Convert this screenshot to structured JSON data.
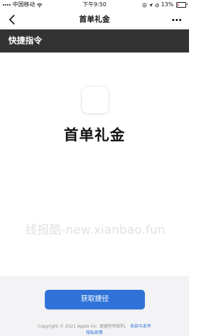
{
  "status_bar": {
    "carrier": "中国移动",
    "time": "下午9:50",
    "battery_percent": "13%",
    "battery_level": 0.13,
    "icons": [
      "wifi-icon",
      "location-icon",
      "alarm-icon",
      "battery-icon"
    ]
  },
  "nav": {
    "title": "首单礼金",
    "back_icon": "chevron-left-icon",
    "more_icon": "more-horizontal-icon"
  },
  "section": {
    "title": "快捷指令"
  },
  "shortcut": {
    "name": "首单礼金"
  },
  "watermark": {
    "text": "线报酷-new.xianbao.fun"
  },
  "footer": {
    "button_label": "获取捷径",
    "copyright_text": "Copyright © 2021 Apple Inc. 保留所有权利。",
    "terms_label": "条款与条件",
    "privacy_label": "隐私政策"
  },
  "colors": {
    "header_background": "#333333",
    "button_blue": "#2F73D8",
    "footer_background": "#F3F3F5",
    "battery_low": "#D63A3A"
  }
}
